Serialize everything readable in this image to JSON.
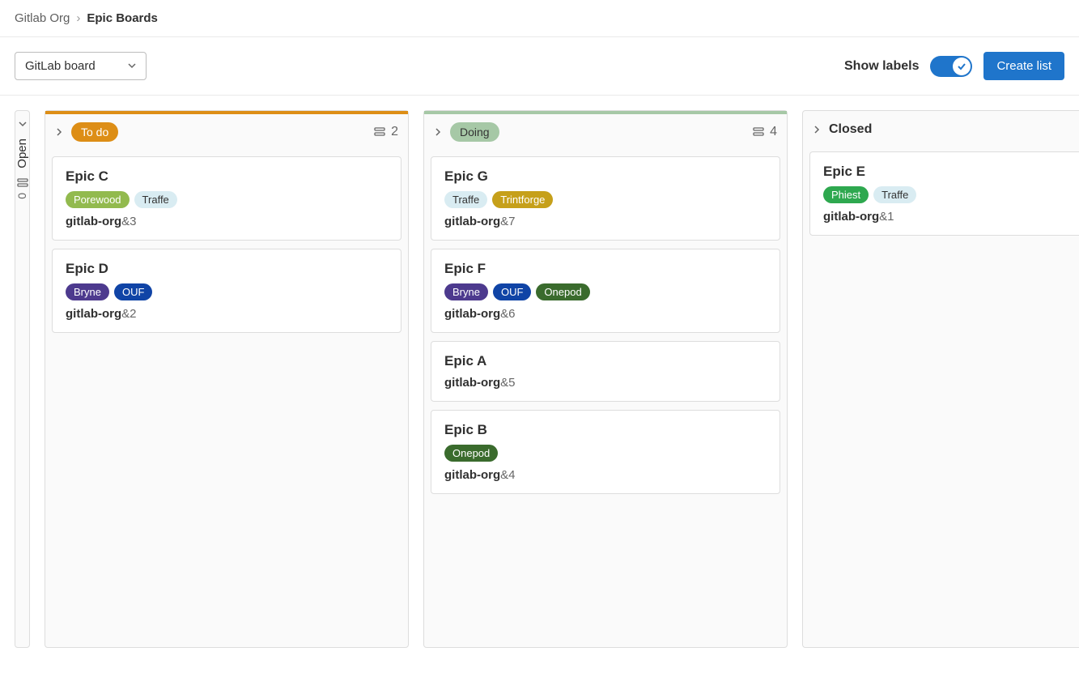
{
  "breadcrumb": {
    "root": "Gitlab Org",
    "current": "Epic Boards"
  },
  "toolbar": {
    "board_name": "GitLab board",
    "show_labels_text": "Show labels",
    "create_list": "Create list"
  },
  "open_collapsed": {
    "label": "Open",
    "count": "0"
  },
  "columns": [
    {
      "name": "To do",
      "pill_bg": "#dd8e16",
      "pill_fg": "#ffffff",
      "top_color": "#dd8e16",
      "count": "2",
      "is_label": true,
      "cards": [
        {
          "title": "Epic C",
          "labels": [
            {
              "text": "Porewood",
              "bg": "#92ba4e",
              "fg": "#ffffff"
            },
            {
              "text": "Traffe",
              "bg": "#d9ecf2",
              "fg": "#333333"
            }
          ],
          "ref_prefix": "gitlab-org",
          "ref_suffix": "&3"
        },
        {
          "title": "Epic D",
          "labels": [
            {
              "text": "Bryne",
              "bg": "#4d3a8e",
              "fg": "#ffffff"
            },
            {
              "text": "OUF",
              "bg": "#1044a6",
              "fg": "#ffffff"
            }
          ],
          "ref_prefix": "gitlab-org",
          "ref_suffix": "&2"
        }
      ]
    },
    {
      "name": "Doing",
      "pill_bg": "#a6c8a6",
      "pill_fg": "#333333",
      "top_color": "#a6c8a6",
      "count": "4",
      "is_label": true,
      "cards": [
        {
          "title": "Epic G",
          "labels": [
            {
              "text": "Traffe",
              "bg": "#d9ecf2",
              "fg": "#333333"
            },
            {
              "text": "Trintforge",
              "bg": "#c6a01a",
              "fg": "#ffffff"
            }
          ],
          "ref_prefix": "gitlab-org",
          "ref_suffix": "&7"
        },
        {
          "title": "Epic F",
          "labels": [
            {
              "text": "Bryne",
              "bg": "#4d3a8e",
              "fg": "#ffffff"
            },
            {
              "text": "OUF",
              "bg": "#1044a6",
              "fg": "#ffffff"
            },
            {
              "text": "Onepod",
              "bg": "#3a6b2d",
              "fg": "#ffffff"
            }
          ],
          "ref_prefix": "gitlab-org",
          "ref_suffix": "&6"
        },
        {
          "title": "Epic A",
          "labels": [],
          "ref_prefix": "gitlab-org",
          "ref_suffix": "&5"
        },
        {
          "title": "Epic B",
          "labels": [
            {
              "text": "Onepod",
              "bg": "#3a6b2d",
              "fg": "#ffffff"
            }
          ],
          "ref_prefix": "gitlab-org",
          "ref_suffix": "&4"
        }
      ]
    },
    {
      "name": "Closed",
      "pill_bg": "",
      "pill_fg": "",
      "top_color": "transparent",
      "count": "",
      "is_label": false,
      "cards": [
        {
          "title": "Epic E",
          "labels": [
            {
              "text": "Phiest",
              "bg": "#2ea84f",
              "fg": "#ffffff"
            },
            {
              "text": "Traffe",
              "bg": "#d9ecf2",
              "fg": "#333333"
            }
          ],
          "ref_prefix": "gitlab-org",
          "ref_suffix": "&1"
        }
      ]
    }
  ]
}
